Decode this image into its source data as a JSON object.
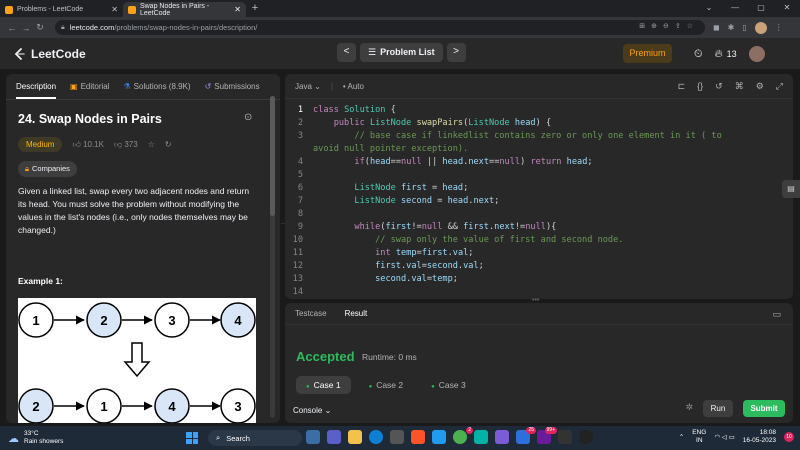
{
  "browser": {
    "tabs": [
      {
        "title": "Problems - LeetCode",
        "active": false
      },
      {
        "title": "Swap Nodes in Pairs - LeetCode",
        "active": true
      }
    ],
    "url_host": "leetcode.com",
    "url_path": "/problems/swap-nodes-in-pairs/description/"
  },
  "header": {
    "logo_text": "LeetCode",
    "prev_label": "<",
    "next_label": ">",
    "problem_list_label": "Problem List",
    "premium_label": "Premium",
    "streak_count": "13"
  },
  "left": {
    "tabs": [
      "Description",
      "Editorial",
      "Solutions (8.9K)",
      "Submissions"
    ],
    "title": "24. Swap Nodes in Pairs",
    "difficulty": "Medium",
    "likes": "10.1K",
    "dislikes": "373",
    "companies_label": "Companies",
    "description": [
      "Given a linked list, swap every two adjacent nodes and return its head. You must solve the problem without modifying the values in the list's nodes (i.e., only nodes themselves may be changed.)"
    ],
    "example_title": "Example 1:",
    "diagram": {
      "row1": [
        "1",
        "2",
        "3",
        "4"
      ],
      "row2": [
        "2",
        "1",
        "4",
        "3"
      ]
    }
  },
  "editor": {
    "language": "Java",
    "mode": "Auto",
    "lines": [
      {
        "n": "1",
        "html": "<span class='kw'>class</span> <span class='ty'>Solution</span> {"
      },
      {
        "n": "2",
        "html": "    <span class='kw'>public</span> <span class='ty'>ListNode</span> <span class='fn'>swapPairs</span>(<span class='ty'>ListNode</span> <span class='vr'>head</span>) {"
      },
      {
        "n": "3",
        "html": "        <span class='cm'>// base case if linkedlist contains zero or only one element in it ( to</span>"
      },
      {
        "n": "",
        "html": "<span class='cm'>avoid null pointer exception).</span>"
      },
      {
        "n": "4",
        "html": "        <span class='kw'>if</span>(<span class='vr'>head</span>==<span class='kw'>null</span> || <span class='vr'>head</span>.<span class='vr'>next</span>==<span class='kw'>null</span>) <span class='kw'>return</span> <span class='vr'>head</span>;"
      },
      {
        "n": "5",
        "html": ""
      },
      {
        "n": "6",
        "html": "        <span class='ty'>ListNode</span> <span class='vr'>first</span> = <span class='vr'>head</span>;"
      },
      {
        "n": "7",
        "html": "        <span class='ty'>ListNode</span> <span class='vr'>second</span> = <span class='vr'>head</span>.<span class='vr'>next</span>;"
      },
      {
        "n": "8",
        "html": ""
      },
      {
        "n": "9",
        "html": "        <span class='kw'>while</span>(<span class='vr'>first</span>!=<span class='kw'>null</span> &amp;&amp; <span class='vr'>first</span>.<span class='vr'>next</span>!=<span class='kw'>null</span>){"
      },
      {
        "n": "10",
        "html": "            <span class='cm'>// swap only the value of first and second node.</span>"
      },
      {
        "n": "11",
        "html": "            <span class='kw'>int</span> <span class='vr'>temp</span>=<span class='vr'>first</span>.<span class='vr'>val</span>;"
      },
      {
        "n": "12",
        "html": "            <span class='vr'>first</span>.<span class='vr'>val</span>=<span class='vr'>second</span>.<span class='vr'>val</span>;"
      },
      {
        "n": "13",
        "html": "            <span class='vr'>second</span>.<span class='vr'>val</span>=<span class='vr'>temp</span>;"
      },
      {
        "n": "14",
        "html": ""
      }
    ]
  },
  "result": {
    "tabs": [
      "Testcase",
      "Result"
    ],
    "status": "Accepted",
    "runtime": "Runtime: 0 ms",
    "cases": [
      "Case 1",
      "Case 2",
      "Case 3"
    ],
    "console_label": "Console",
    "run_label": "Run",
    "submit_label": "Submit"
  },
  "taskbar": {
    "temp": "33°C",
    "weather": "Rain showers",
    "search_placeholder": "Search",
    "lang_top": "ENG",
    "lang_bottom": "IN",
    "time": "18:08",
    "date": "16-05-2023",
    "notif_count": "10",
    "app_badges": [
      "2",
      "25",
      "99+"
    ]
  },
  "colors": {
    "accent": "#ffa116",
    "accepted": "#2cbb5d",
    "medium": "#ffb800"
  }
}
